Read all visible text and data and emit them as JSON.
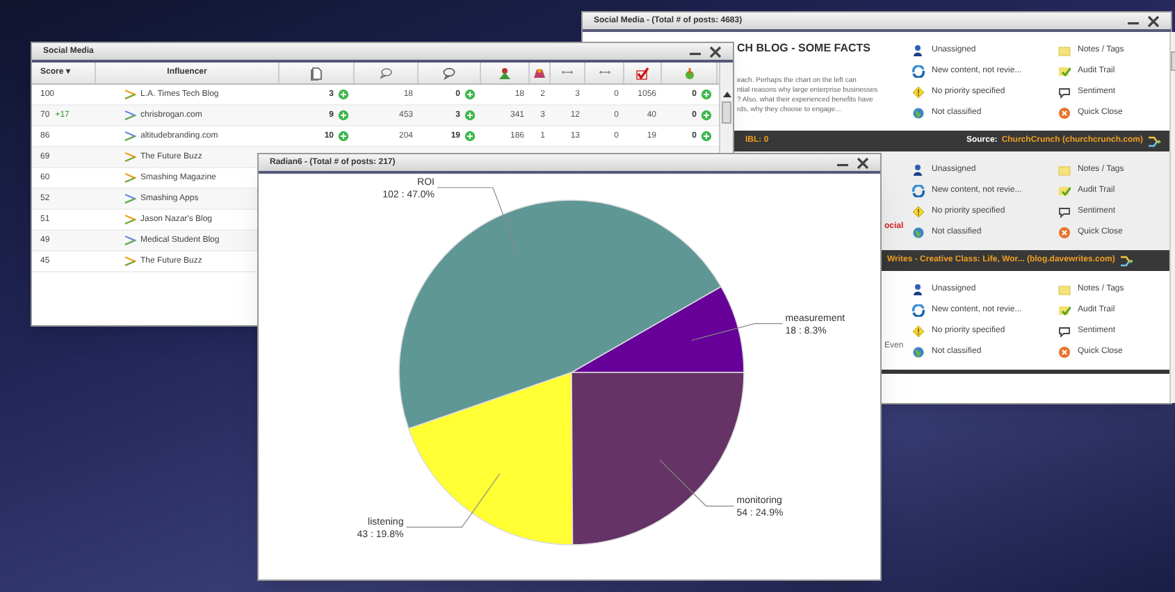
{
  "stream_window": {
    "title": "Social Media - (Total # of posts: 4683)",
    "items": [
      {
        "kind": "post",
        "headline": "CH BLOG - SOME FACTS",
        "snippet": [
          "each. Perhaps the chart on the left can",
          "ntial reasons why large enterprise businesses",
          "? Also, what their experienced benefits have",
          "rds, why they choose to engage..."
        ],
        "actions": [
          "Unassigned",
          "New content, not revie...",
          "No priority specified",
          "Not classified",
          "Notes / Tags",
          "Audit Trail",
          "Sentiment",
          "Quick Close"
        ]
      },
      {
        "kind": "bar",
        "ibl": "IBL: 0",
        "source_label": "Source:",
        "source": "ChurchCrunch (churchcrunch.com)"
      },
      {
        "kind": "post",
        "fragment": {
          "text": "ocial",
          "emphasis": true
        },
        "actions": [
          "Unassigned",
          "New content, not revie...",
          "No priority specified",
          "Not classified",
          "Notes / Tags",
          "Audit Trail",
          "Sentiment",
          "Quick Close"
        ]
      },
      {
        "kind": "bar",
        "source": "Writes - Creative Class: Life, Wor... (blog.davewrites.com)"
      },
      {
        "kind": "post",
        "fragment": {
          "text": "Even",
          "emphasis": false
        },
        "actions": [
          "Unassigned",
          "New content, not revie...",
          "No priority specified",
          "Not classified",
          "Notes / Tags",
          "Audit Trail",
          "Sentiment",
          "Quick Close"
        ]
      }
    ]
  },
  "table_window": {
    "title": "Social Media",
    "columns": [
      "Score ▾",
      "Influencer"
    ],
    "rows": [
      {
        "score": "100",
        "influencer": "L.A. Times Tech Blog",
        "cells": [
          {
            "text": "3",
            "plus": true
          },
          {
            "text": "18",
            "plus": false
          },
          {
            "text": "0",
            "plus": true
          },
          {
            "text": "18",
            "plus": false
          },
          {
            "text": "2",
            "plus": false
          },
          {
            "text": "3",
            "plus": false
          },
          {
            "text": "0",
            "plus": false
          },
          {
            "text": "1056",
            "plus": false
          },
          {
            "text": "0",
            "plus": true
          }
        ]
      },
      {
        "score": "70",
        "change": "+17",
        "influencer": "chrisbrogan.com",
        "cells": [
          {
            "text": "9",
            "plus": true
          },
          {
            "text": "453",
            "plus": false
          },
          {
            "text": "3",
            "plus": true
          },
          {
            "text": "341",
            "plus": false
          },
          {
            "text": "3",
            "plus": false
          },
          {
            "text": "12",
            "plus": false
          },
          {
            "text": "0",
            "plus": false
          },
          {
            "text": "40",
            "plus": false
          },
          {
            "text": "0",
            "plus": true
          }
        ]
      },
      {
        "score": "86",
        "influencer": "altitudebranding.com",
        "cells": [
          {
            "text": "10",
            "plus": true
          },
          {
            "text": "204",
            "plus": false
          },
          {
            "text": "19",
            "plus": true
          },
          {
            "text": "186",
            "plus": false
          },
          {
            "text": "1",
            "plus": false
          },
          {
            "text": "13",
            "plus": false
          },
          {
            "text": "0",
            "plus": false
          },
          {
            "text": "19",
            "plus": false
          },
          {
            "text": "0",
            "plus": true
          }
        ]
      },
      {
        "score": "69",
        "influencer": "The Future Buzz"
      },
      {
        "score": "60",
        "influencer": "Smashing Magazine"
      },
      {
        "score": "52",
        "influencer": "Smashing Apps"
      },
      {
        "score": "51",
        "influencer": "Jason Nazar's Blog"
      },
      {
        "score": "49",
        "influencer": "Medical Student Blog"
      },
      {
        "score": "45",
        "influencer": "The Future Buzz"
      }
    ]
  },
  "chart_window": {
    "title": "Radian6 - (Total # of posts: 217)",
    "chart_data": {
      "type": "pie",
      "categories": [
        "measurement",
        "ROI",
        "listening",
        "monitoring"
      ],
      "values": [
        8.3,
        47.0,
        19.8,
        24.9
      ],
      "colors": [
        "#660099",
        "#5f9795",
        "#ffff33",
        "#663366"
      ],
      "value_labels": [
        "18 : 8.3%",
        "102 : 47.0%",
        "43 : 19.8%",
        "54 : 24.9%"
      ]
    }
  }
}
